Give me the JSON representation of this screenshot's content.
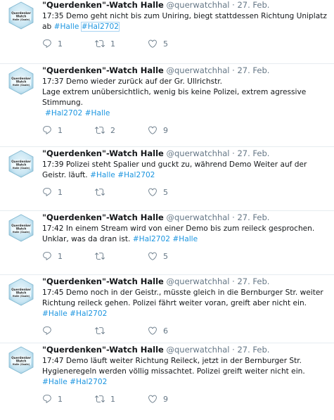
{
  "avatar_text": "Querdenker Watch Halle (Saale)",
  "colors": {
    "link": "#1b95e0",
    "muted": "#657786",
    "text": "#14171a",
    "divider": "#e6ecf0"
  },
  "icons": {
    "reply": "speech-bubble-icon",
    "retweet": "retweet-icon",
    "like": "heart-icon"
  },
  "tweets": [
    {
      "name": "\"Querdenken\"-Watch Halle",
      "handle": "@querwatchhal",
      "sep": "·",
      "date": "27. Feb.",
      "lines": [
        "17:35 Demo geht nicht bis zum Uniring, biegt stattdessen Richtung Uniplatz",
        "ab"
      ],
      "hashtags": [
        "#Halle",
        "#Hal2702"
      ],
      "replies": "1",
      "retweets": "1",
      "likes": "5"
    },
    {
      "name": "\"Querdenken\"-Watch Halle",
      "handle": "@querwatchhal",
      "sep": "·",
      "date": "27. Feb.",
      "lines": [
        "17:37 Demo wieder zurück auf der Gr. Ullrichstr.",
        "Lage extrem unübersichtlich, wenig bis keine Polizei, extrem agressive",
        "Stimmung."
      ],
      "hashtags": [
        "#Hal2702",
        "#Halle"
      ],
      "replies": "1",
      "retweets": "2",
      "likes": "9"
    },
    {
      "name": "\"Querdenken\"-Watch Halle",
      "handle": "@querwatchhal",
      "sep": "·",
      "date": "27. Feb.",
      "lines": [
        "17:39 Polizei steht Spalier und guckt zu, während Demo Weiter auf der",
        "Geistr. läuft."
      ],
      "hashtags": [
        "#Halle",
        "#Hal2702"
      ],
      "replies": "1",
      "retweets": "",
      "likes": "5"
    },
    {
      "name": "\"Querdenken\"-Watch Halle",
      "handle": "@querwatchhal",
      "sep": "·",
      "date": "27. Feb.",
      "lines": [
        "17:42 In einem Stream wird von einer Demo bis zum reileck gesprochen.",
        "Unklar, was da dran ist."
      ],
      "hashtags": [
        "#Hal2702",
        "#Halle"
      ],
      "replies": "1",
      "retweets": "",
      "likes": "5"
    },
    {
      "name": "\"Querdenken\"-Watch Halle",
      "handle": "@querwatchhal",
      "sep": "·",
      "date": "27. Feb.",
      "lines": [
        "17:45 Demo noch in der Geistr., müsste gleich in die Bernburger Str. weiter",
        "Richtung reileck gehen. Polizei fährt weiter voran, greift aber nicht ein."
      ],
      "hashtags": [
        "#Halle",
        "#Hal2702"
      ],
      "replies": "",
      "retweets": "",
      "likes": "6"
    },
    {
      "name": "\"Querdenken\"-Watch Halle",
      "handle": "@querwatchhal",
      "sep": "·",
      "date": "27. Feb.",
      "lines": [
        "17:47 Demo läuft weiter Richtung Reileck, jetzt in der Bernburger Str.",
        "Hygieneregeln werden völlig missachtet. Polizei greift weiter nicht ein."
      ],
      "hashtags": [
        "#Halle",
        "#Hal2702"
      ],
      "replies": "1",
      "retweets": "1",
      "likes": "9"
    }
  ]
}
